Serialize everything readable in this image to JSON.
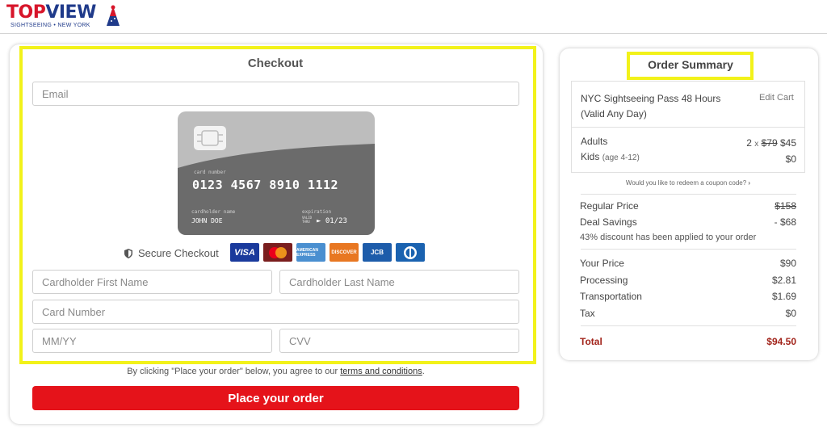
{
  "brand": {
    "logo_top": "TOP",
    "logo_view": "VIEW",
    "logo_sub": "SIGHTSEEING • NEW YORK",
    "colors": {
      "red": "#d7152a",
      "blue": "#1f3a8a"
    }
  },
  "checkout": {
    "title": "Checkout",
    "email_placeholder": "Email",
    "card_preview": {
      "number_label": "card number",
      "number": "0123 4567 8910 1112",
      "holder_label": "cardholder name",
      "holder": "JOHN DOE",
      "expiration_label": "expiration",
      "valid_thru": "VALID THRU",
      "expiration": "► 01/23"
    },
    "secure_label": "Secure Checkout",
    "card_brands": [
      "VISA",
      "MasterCard",
      "AMERICAN EXPRESS",
      "DISCOVER",
      "JCB",
      "Diners"
    ],
    "first_name_placeholder": "Cardholder First Name",
    "last_name_placeholder": "Cardholder Last Name",
    "card_number_placeholder": "Card Number",
    "expiry_placeholder": "MM/YY",
    "cvv_placeholder": "CVV",
    "terms_prefix": "By clicking \"Place your order\" below, you agree to our ",
    "terms_link": "terms and conditions",
    "terms_suffix": ".",
    "place_order": "Place your order",
    "accent_color": "#e5131a"
  },
  "summary": {
    "title": "Order Summary",
    "item_name": "NYC Sightseeing Pass 48 Hours (Valid Any Day)",
    "edit_cart": "Edit Cart",
    "adults_label": "Adults",
    "adults_qty": "2",
    "adults_x": "x",
    "adults_orig_price": "$79",
    "adults_price": "$45",
    "kids_label": "Kids",
    "kids_age": "(age 4-12)",
    "kids_price": "$0",
    "coupon_prompt": "Would you like to redeem a coupon code?",
    "regular_price_label": "Regular Price",
    "regular_price": "$158",
    "deal_savings_label": "Deal Savings",
    "deal_savings": "- $68",
    "discount_note": "43% discount has been applied to your order",
    "your_price_label": "Your Price",
    "your_price": "$90",
    "processing_label": "Processing",
    "processing": "$2.81",
    "transportation_label": "Transportation",
    "transportation": "$1.69",
    "tax_label": "Tax",
    "tax": "$0",
    "total_label": "Total",
    "total": "$94.50",
    "total_color": "#a2241b"
  }
}
